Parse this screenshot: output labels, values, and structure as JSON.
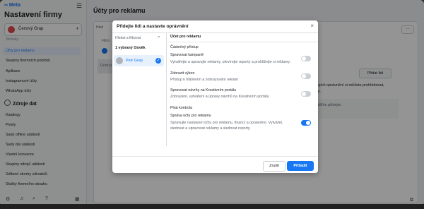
{
  "sidebar": {
    "logo": "∞ Meta",
    "app_title": "Nastavení firmy",
    "account_name": "Čerstvý Grap",
    "items_top": [
      "Stránky",
      "Účty pro reklamu",
      "Skupiny firemních položek",
      "Aplikace",
      "Instagramové účty",
      "WhatsApp účty"
    ],
    "section_title": "Zdroje dat",
    "items_data": [
      "Katalogy",
      "Pixely",
      "Sady offline událostí",
      "Sady dat událostí",
      "Vlastní konverze",
      "Skupiny zdrojů událostí",
      "Sdílené okruhy uživatelů",
      "Složky firemního obsahu"
    ]
  },
  "main": {
    "title": "Účty pro reklamu",
    "search_placeholder": "Hled",
    "filter": "Filtro",
    "row_label": "Účet p",
    "more": "···",
    "add_people": "Přidat lidi",
    "text1": "jejich oprávnění si můžete prohlédnout,",
    "text2": "m.",
    "text3": "alšího přidejte."
  },
  "modal": {
    "title": "Přidejte lidi a nastavte oprávnění",
    "close": "×",
    "search_placeholder": "Hledat a filtrovat",
    "selected_label": "1 vybraný člověk",
    "person_name": "Petr Grap",
    "section_account": "Účet pro reklamu",
    "partial_access": "Částečný přístup",
    "perm1_title": "Spravovat kampaně",
    "perm1_desc": "Vytvářejte a upravujte reklamy, otevírejte reporty a prohlížejte si reklamy.",
    "perm2_title": "Zobrazit výkon",
    "perm2_desc": "Přístup k hlášením a zobrazování reklam",
    "perm3_title": "Spravovat návrhy na Kreativním portálu",
    "perm3_desc": "Zobrazení, vytváření a úpravy návrhů na Kreativním portálu",
    "full_control": "Plná kontrola",
    "perm4_title": "Správa účtu pro reklamu",
    "perm4_desc1": "Spravujte nastavení účtu pro reklamu, financí a oprávnění. Vytvářet,",
    "perm4_desc2": "sledovat a upravovat reklamy a sledovat reporty.",
    "cancel": "Zrušit",
    "add": "Přiřadit"
  }
}
